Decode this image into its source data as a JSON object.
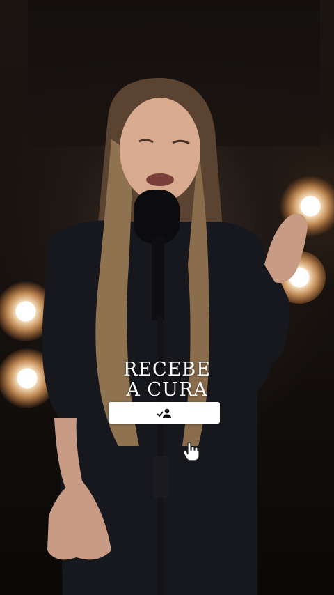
{
  "overlay": {
    "title_line1": "RECEBE",
    "title_line2": "A CURA"
  },
  "follow_button": {
    "icon": "follow-user-check-icon"
  },
  "cursor": {
    "icon": "hand-pointer-icon"
  },
  "colors": {
    "text": "#ffffff",
    "button_bg": "#ffffff",
    "background": "#1c1512"
  }
}
